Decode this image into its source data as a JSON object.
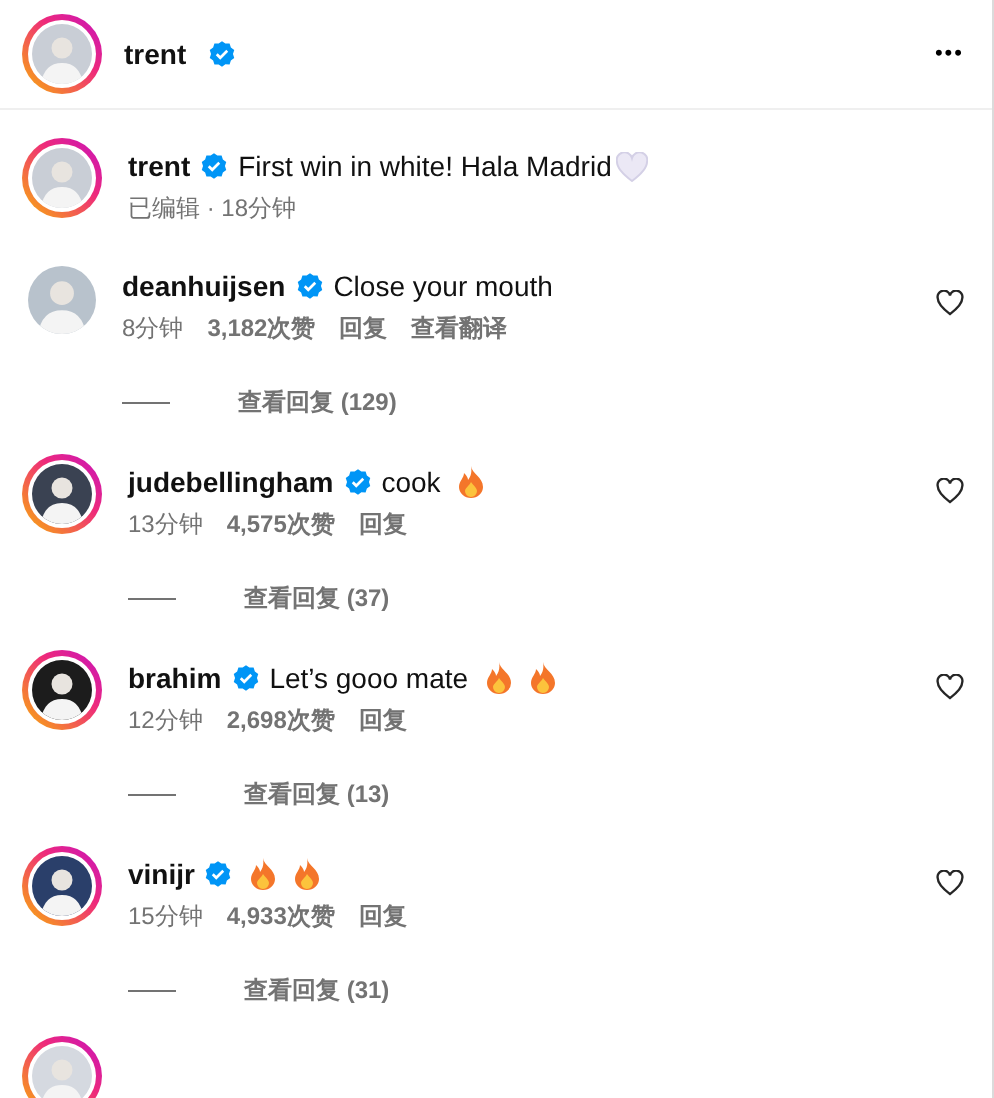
{
  "header": {
    "username": "trent",
    "verified": true,
    "story": true,
    "more": "•••"
  },
  "post": {
    "username": "trent",
    "verified": true,
    "story": true,
    "text": "First win in white! Hala Madrid",
    "emoji": [
      {
        "kind": "heart"
      }
    ],
    "meta": "已编辑 · 18分钟"
  },
  "comments": [
    {
      "username": "deanhuijsen",
      "verified": true,
      "story": false,
      "text": "Close your mouth",
      "time": "8分钟",
      "likes": "3,182次赞",
      "reply": "回复",
      "translate": "查看翻译",
      "view_replies": "查看回复 (129)",
      "liked": false
    },
    {
      "username": "judebellingham",
      "verified": true,
      "story": true,
      "text": "cook",
      "emoji": [
        {
          "kind": "fire"
        }
      ],
      "time": "13分钟",
      "likes": "4,575次赞",
      "reply": "回复",
      "view_replies": "查看回复 (37)",
      "liked": false
    },
    {
      "username": "brahim",
      "verified": true,
      "story": true,
      "text": "Let’s gooo mate",
      "emoji": [
        {
          "kind": "fire"
        },
        {
          "kind": "fire"
        }
      ],
      "time": "12分钟",
      "likes": "2,698次赞",
      "reply": "回复",
      "view_replies": "查看回复 (13)",
      "liked": false
    },
    {
      "username": "vinijr",
      "verified": true,
      "story": true,
      "emoji": [
        {
          "kind": "fire"
        },
        {
          "kind": "fire"
        }
      ],
      "time": "15分钟",
      "likes": "4,933次赞",
      "reply": "回复",
      "view_replies": "查看回复 (31)",
      "liked": false
    }
  ],
  "next_comment": {
    "story": true
  }
}
